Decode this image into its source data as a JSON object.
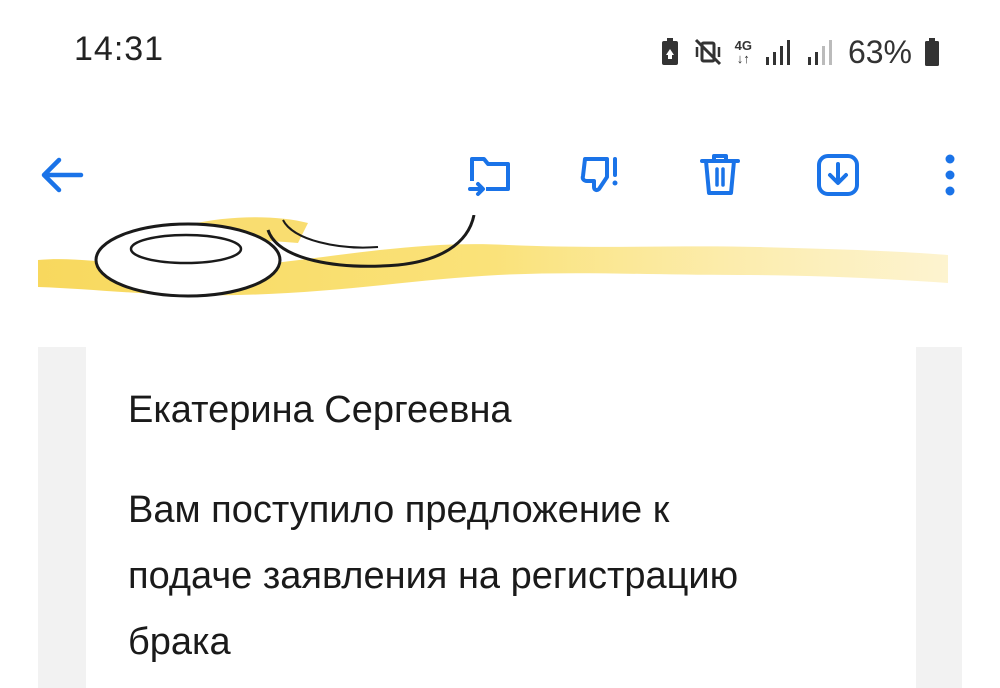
{
  "status_bar": {
    "time": "14:31",
    "network_label": "4G",
    "battery_percent": "63%",
    "icons": [
      "battery-saver-icon",
      "vibrate-mute-icon",
      "network-4g-icon",
      "signal-bars-icon",
      "signal-bars-secondary-icon",
      "battery-icon"
    ]
  },
  "toolbar": {
    "actions": [
      "back-arrow-icon",
      "move-to-folder-icon",
      "spam-thumbs-down-icon",
      "delete-trash-icon",
      "download-icon",
      "more-vert-icon"
    ],
    "accent_color": "#1a73e8"
  },
  "banner": {
    "accent_color": "#f7d44c"
  },
  "message": {
    "recipient": "Екатерина Сергеевна",
    "lines": [
      "Вам поступило предложение к",
      "подаче заявления на регистрацию",
      "брака"
    ]
  }
}
